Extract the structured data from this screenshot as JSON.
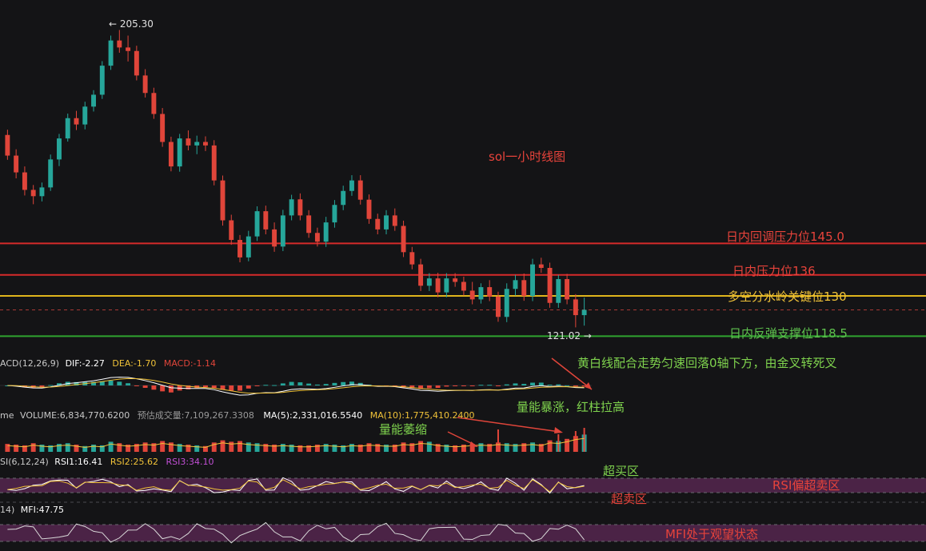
{
  "chart_data": {
    "type": "candlestick",
    "title": "sol一小时线图",
    "price_range": [
      114,
      210
    ],
    "price_high_label": "← 205.30",
    "price_low_label": "121.02 →",
    "candles_ohlc": [
      [
        176.0,
        177.5,
        168.9,
        170.1
      ],
      [
        170.1,
        171.9,
        163.6,
        165.3
      ],
      [
        165.3,
        167.0,
        158.7,
        160.3
      ],
      [
        160.3,
        161.7,
        156.2,
        158.5
      ],
      [
        158.5,
        162.4,
        157.0,
        161.0
      ],
      [
        161.0,
        170.4,
        160.0,
        169.0
      ],
      [
        169.0,
        176.3,
        167.1,
        175.0
      ],
      [
        175.0,
        182.1,
        174.1,
        180.8
      ],
      [
        180.8,
        182.9,
        177.4,
        179.0
      ],
      [
        179.0,
        185.5,
        177.6,
        184.1
      ],
      [
        184.1,
        188.8,
        182.7,
        187.5
      ],
      [
        187.5,
        197.1,
        186.3,
        195.8
      ],
      [
        195.8,
        204.4,
        194.6,
        203.0
      ],
      [
        203.0,
        206.0,
        199.5,
        201.0
      ],
      [
        201.0,
        204.4,
        197.0,
        200.0
      ],
      [
        200.0,
        201.5,
        191.6,
        193.0
      ],
      [
        193.0,
        194.8,
        186.7,
        188.0
      ],
      [
        188.0,
        189.5,
        180.6,
        182.0
      ],
      [
        182.0,
        183.7,
        172.6,
        174.0
      ],
      [
        174.0,
        175.5,
        165.6,
        167.0
      ],
      [
        167.0,
        176.3,
        165.5,
        175.0
      ],
      [
        175.0,
        177.3,
        171.6,
        173.0
      ],
      [
        173.0,
        175.8,
        170.5,
        174.0
      ],
      [
        174.0,
        175.6,
        171.4,
        173.0
      ],
      [
        173.0,
        174.5,
        161.6,
        163.0
      ],
      [
        163.0,
        164.4,
        150.1,
        151.6
      ],
      [
        151.6,
        153.2,
        144.6,
        146.0
      ],
      [
        146.0,
        147.4,
        139.6,
        141.0
      ],
      [
        141.0,
        148.6,
        139.9,
        147.0
      ],
      [
        147.0,
        155.6,
        145.7,
        154.2
      ],
      [
        154.2,
        155.8,
        147.6,
        149.0
      ],
      [
        149.0,
        151.0,
        142.6,
        144.1
      ],
      [
        144.1,
        154.6,
        142.8,
        153.0
      ],
      [
        153.0,
        158.9,
        151.6,
        157.6
      ],
      [
        157.6,
        159.3,
        151.6,
        153.0
      ],
      [
        153.0,
        154.5,
        146.6,
        148.0
      ],
      [
        148.0,
        149.5,
        144.1,
        145.5
      ],
      [
        145.5,
        152.6,
        144.0,
        151.0
      ],
      [
        151.0,
        157.4,
        149.5,
        156.0
      ],
      [
        156.0,
        161.5,
        154.5,
        160.0
      ],
      [
        160.0,
        164.5,
        158.6,
        163.0
      ],
      [
        163.0,
        164.5,
        156.1,
        157.5
      ],
      [
        157.5,
        159.0,
        150.6,
        152.0
      ],
      [
        152.0,
        153.5,
        147.6,
        149.0
      ],
      [
        149.0,
        154.5,
        147.6,
        153.0
      ],
      [
        153.0,
        155.0,
        148.6,
        150.0
      ],
      [
        150.0,
        151.5,
        141.1,
        142.5
      ],
      [
        142.5,
        144.0,
        137.6,
        139.0
      ],
      [
        139.0,
        140.6,
        131.4,
        132.9
      ],
      [
        132.9,
        136.5,
        131.4,
        135.0
      ],
      [
        135.0,
        136.6,
        129.6,
        131.0
      ],
      [
        131.0,
        136.5,
        129.6,
        135.0
      ],
      [
        135.0,
        136.5,
        132.6,
        134.0
      ],
      [
        134.0,
        135.5,
        130.1,
        131.5
      ],
      [
        131.5,
        134.0,
        127.6,
        129.0
      ],
      [
        129.0,
        133.6,
        127.8,
        132.5
      ],
      [
        132.5,
        134.5,
        128.5,
        129.8
      ],
      [
        129.8,
        131.2,
        122.6,
        124.0
      ],
      [
        124.0,
        133.6,
        122.5,
        132.0
      ],
      [
        132.0,
        136.0,
        130.1,
        134.5
      ],
      [
        134.5,
        136.4,
        128.6,
        130.0
      ],
      [
        130.0,
        140.6,
        128.5,
        139.0
      ],
      [
        139.0,
        140.9,
        136.6,
        138.0
      ],
      [
        138.0,
        139.5,
        126.6,
        128.0
      ],
      [
        128.0,
        136.0,
        126.6,
        134.8
      ],
      [
        134.8,
        136.3,
        127.6,
        129.0
      ],
      [
        129.0,
        130.5,
        121.0,
        124.5
      ],
      [
        124.5,
        129.5,
        121.5,
        126.0
      ]
    ],
    "volume_ma": [
      1.1,
      1.0,
      0.9,
      1.2,
      1.0,
      0.9,
      1.1,
      1.2,
      1.0,
      0.8,
      1.0,
      0.9,
      1.4,
      1.2,
      1.0,
      1.1,
      1.3,
      1.2,
      1.5,
      1.3,
      1.1,
      1.0,
      0.9,
      0.8,
      1.3,
      1.6,
      1.4,
      1.5,
      1.3,
      1.2,
      1.1,
      1.0,
      1.1,
      1.0,
      0.9,
      0.9,
      1.0,
      1.1,
      1.0,
      0.9,
      1.1,
      1.0,
      1.2,
      1.1,
      1.0,
      1.0,
      1.3,
      1.2,
      1.5,
      1.4,
      1.1,
      1.0,
      0.9,
      1.0,
      1.1,
      1.2,
      1.1,
      1.3,
      1.2,
      1.1,
      1.2,
      1.3,
      1.1,
      1.6,
      1.5,
      1.8,
      2.2,
      2.4
    ],
    "levels": [
      {
        "label": "日内回调压力位145.0",
        "value": 145.0,
        "color": "#d62a2a"
      },
      {
        "label": "日内压力位136",
        "value": 136,
        "color": "#d62a2a"
      },
      {
        "label": "多空分水岭关键位130",
        "value": 130,
        "color": "#e0b51c"
      },
      {
        "label": "日内反弹支撑位118.5",
        "value": 118.5,
        "color": "#2fa32f"
      }
    ],
    "indicators": {
      "macd": {
        "name": "ACD(12,26,9)",
        "dif": "DIF:-2.27",
        "dea": "DEA:-1.70",
        "macd": "MACD:-1.14"
      },
      "volume": {
        "name": "me",
        "volume": "VOLUME:6,834,770.6200",
        "est": "预估成交量:7,109,267.3308",
        "ma5": "MA(5):2,331,016.5540",
        "ma10": "MA(10):1,775,410.2400"
      },
      "rsi": {
        "name": "SI(6,12,24)",
        "rsi1": "RSI1:16.41",
        "rsi2": "RSI2:25.62",
        "rsi3": "RSI3:34.10"
      },
      "mfi": {
        "name": "14)",
        "mfi": "MFI:47.75"
      }
    },
    "annotations": {
      "macd_note": "黄白线配合走势匀速回落0轴下方，由金叉转死叉",
      "volume_note": "量能暴涨，红柱拉高",
      "volume_shrink": "量能萎缩",
      "overbought": "超买区",
      "oversold": "超卖区",
      "rsi_note": "RSI偏超卖区",
      "mfi_note": "MFI处于观望状态"
    }
  },
  "colors": {
    "up": "#26a69a",
    "down": "#e0453a",
    "background": "#141416",
    "grid_line": "#3a3a3e"
  }
}
